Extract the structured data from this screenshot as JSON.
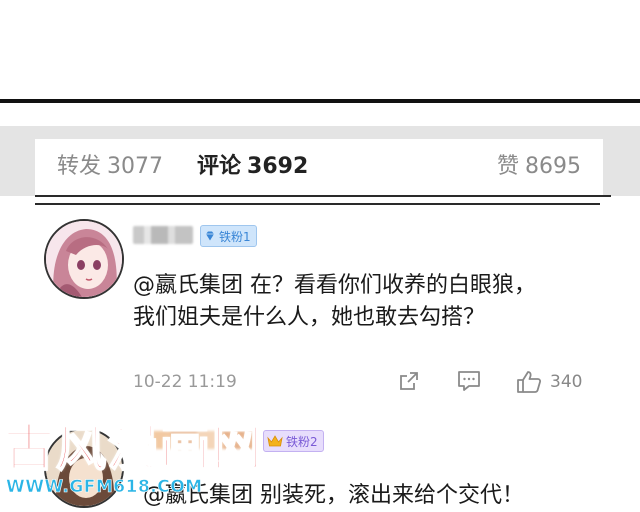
{
  "tabs": {
    "repost": {
      "label": "转发",
      "count": "3077"
    },
    "comments": {
      "label": "评论",
      "count": "3692"
    },
    "likes": {
      "label": "赞",
      "count": "8695"
    }
  },
  "comments": [
    {
      "badge": "铁粉1",
      "text_line1": "@嬴氏集团 在？看看你们收养的白眼狼，",
      "text_line2": "我们姐夫是什么人，她也敢去勾搭？",
      "time": "10-22 11:19",
      "like_count": "340"
    },
    {
      "badge": "铁粉2",
      "text_line1": "@嬴氏集团 别装死，滚出来给个交代！"
    }
  ],
  "icons": {
    "share": "share-icon",
    "comment": "comment-icon",
    "like": "thumbs-up-icon",
    "badge": "diamond-icon",
    "badge2": "crown-icon"
  },
  "watermark": {
    "text": "古风漫画网",
    "url": "WWW.GFM618.COM"
  },
  "colors": {
    "badge_blue": "#3a86d6",
    "badge_purple": "#7a5bd6",
    "watermark": "#e2262b"
  }
}
